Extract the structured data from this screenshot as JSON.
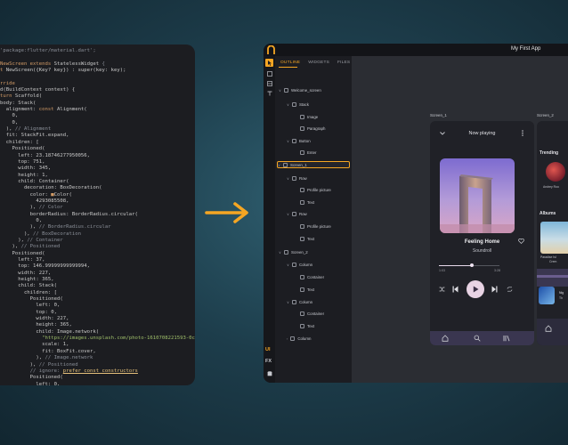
{
  "code": {
    "lines": [
      [
        [
          "c-g",
          "'package:flutter/material.dart';"
        ]
      ],
      [
        [
          "c-w",
          ""
        ]
      ],
      [
        [
          "c-k",
          "NewScreen extends "
        ],
        [
          "c-w",
          "StatelessWidget "
        ],
        [
          "c-g",
          "{"
        ]
      ],
      [
        [
          "c-k",
          "t "
        ],
        [
          "c-w",
          "NewScreen({Key? key}) : super(key: key);"
        ]
      ],
      [
        [
          "c-w",
          ""
        ]
      ],
      [
        [
          "c-k",
          "rride"
        ]
      ],
      [
        [
          "c-w",
          "d(BuildContext context) {"
        ]
      ],
      [
        [
          "c-k",
          "turn "
        ],
        [
          "c-w",
          "Scaffold("
        ]
      ],
      [
        [
          "c-w",
          "body: Stack("
        ]
      ],
      [
        [
          "c-w",
          "  alignment: "
        ],
        [
          "c-k",
          "const "
        ],
        [
          "c-w",
          "Alignment("
        ]
      ],
      [
        [
          "c-w",
          "    0,"
        ]
      ],
      [
        [
          "c-w",
          "    0,"
        ]
      ],
      [
        [
          "c-w",
          "  ), "
        ],
        [
          "c-g",
          "// Alignment"
        ]
      ],
      [
        [
          "c-w",
          "  fit: StackFit.expand,"
        ]
      ],
      [
        [
          "c-w",
          "  children: ["
        ]
      ],
      [
        [
          "c-w",
          "    Positioned("
        ]
      ],
      [
        [
          "c-w",
          "      left: 23.18746277950056,"
        ]
      ],
      [
        [
          "c-w",
          "      top: 751,"
        ]
      ],
      [
        [
          "c-w",
          "      width: 345,"
        ]
      ],
      [
        [
          "c-w",
          "      height: 1,"
        ]
      ],
      [
        [
          "c-w",
          "      child: Container("
        ]
      ],
      [
        [
          "c-w",
          "        decoration: BoxDecoration("
        ]
      ],
      [
        [
          "c-w",
          "          color: "
        ],
        [
          "c-k",
          "■"
        ],
        [
          "c-w",
          "Color("
        ]
      ],
      [
        [
          "c-w",
          "            4293085508,"
        ]
      ],
      [
        [
          "c-w",
          "          ), "
        ],
        [
          "c-g",
          "// Color"
        ]
      ],
      [
        [
          "c-w",
          "          borderRadius: BorderRadius.circular("
        ]
      ],
      [
        [
          "c-w",
          "            0,"
        ]
      ],
      [
        [
          "c-w",
          "          ), "
        ],
        [
          "c-g",
          "// BorderRadius.circular"
        ]
      ],
      [
        [
          "c-w",
          "        ), "
        ],
        [
          "c-g",
          "// BoxDecoration"
        ]
      ],
      [
        [
          "c-w",
          "      ), "
        ],
        [
          "c-g",
          "// Container"
        ]
      ],
      [
        [
          "c-w",
          "    ), "
        ],
        [
          "c-g",
          "// Positioned"
        ]
      ],
      [
        [
          "c-w",
          "    Positioned("
        ]
      ],
      [
        [
          "c-w",
          "      left: 37,"
        ]
      ],
      [
        [
          "c-w",
          "      top: 146.99999999999994,"
        ]
      ],
      [
        [
          "c-w",
          "      width: 227,"
        ]
      ],
      [
        [
          "c-w",
          "      height: 365,"
        ]
      ],
      [
        [
          "c-w",
          "      child: Stack("
        ]
      ],
      [
        [
          "c-w",
          "        children: ["
        ]
      ],
      [
        [
          "c-w",
          "          Positioned("
        ]
      ],
      [
        [
          "c-w",
          "            left: 0,"
        ]
      ],
      [
        [
          "c-w",
          "            top: 0,"
        ]
      ],
      [
        [
          "c-w",
          "            width: 227,"
        ]
      ],
      [
        [
          "c-w",
          "            height: 365,"
        ]
      ],
      [
        [
          "c-w",
          "            child: Image.network("
        ]
      ],
      [
        [
          "c-w",
          "              "
        ],
        [
          "c-s",
          "\"https://images.unsplash.com/photo-1610708221593-0c900c4551d3"
        ]
      ],
      [
        [
          "c-w",
          "              scale: 1,"
        ]
      ],
      [
        [
          "c-w",
          "              fit: BoxFit.cover,"
        ]
      ],
      [
        [
          "c-w",
          "            ), "
        ],
        [
          "c-g",
          "// Image.network"
        ]
      ],
      [
        [
          "c-w",
          "          ), "
        ],
        [
          "c-g",
          "// Positioned"
        ]
      ],
      [
        [
          "c-w",
          "          "
        ],
        [
          "c-g",
          "// ignore: "
        ],
        [
          "c-u",
          "prefer_const_constructors"
        ]
      ],
      [
        [
          "c-w",
          "          Positioned("
        ]
      ],
      [
        [
          "c-w",
          "            left: 0,"
        ]
      ]
    ]
  },
  "app": {
    "title": "My First App",
    "tabs": [
      "OUTLINE",
      "WIDGETS",
      "FILES"
    ],
    "rail_text": [
      "UI",
      "FX"
    ],
    "tree": [
      {
        "label": "Welcome_screen",
        "indent": 0,
        "chev": "∨",
        "icon": true
      },
      {
        "label": "Stack",
        "indent": 1,
        "chev": "∨",
        "icon": true
      },
      {
        "label": "Image",
        "indent": 2,
        "chev": "",
        "icon": true
      },
      {
        "label": "Paragraph",
        "indent": 2,
        "chev": "",
        "icon": true
      },
      {
        "label": "Button",
        "indent": 1,
        "chev": "∨",
        "icon": true
      },
      {
        "label": "Enter",
        "indent": 2,
        "chev": "",
        "icon": true
      },
      {
        "label": "Screen_1",
        "indent": 0,
        "chev": "∨",
        "icon": true,
        "selected": true
      },
      {
        "label": "Row",
        "indent": 1,
        "chev": "∨",
        "icon": true
      },
      {
        "label": "Profile picture",
        "indent": 2,
        "chev": "",
        "icon": true
      },
      {
        "label": "Text",
        "indent": 2,
        "chev": "",
        "icon": true
      },
      {
        "label": "Row",
        "indent": 1,
        "chev": "∨",
        "icon": true
      },
      {
        "label": "Profile picture",
        "indent": 2,
        "chev": "",
        "icon": true
      },
      {
        "label": "Text",
        "indent": 2,
        "chev": "",
        "icon": true
      },
      {
        "label": "Screen_2",
        "indent": 0,
        "chev": "∨",
        "icon": true
      },
      {
        "label": "Column",
        "indent": 1,
        "chev": "∨",
        "icon": true
      },
      {
        "label": "Container",
        "indent": 2,
        "chev": "",
        "icon": true
      },
      {
        "label": "Text",
        "indent": 2,
        "chev": "",
        "icon": true
      },
      {
        "label": "Column",
        "indent": 1,
        "chev": "∨",
        "icon": true
      },
      {
        "label": "Container",
        "indent": 2,
        "chev": "",
        "icon": true
      },
      {
        "label": "Text",
        "indent": 2,
        "chev": "",
        "icon": true
      },
      {
        "label": "Column",
        "indent": 1,
        "chev": "›",
        "icon": true
      }
    ],
    "screen1_label": "Screen_1",
    "screen2_label": "Screen_2",
    "player": {
      "header": "Now playing",
      "song": "Feeling Home",
      "artist": "Soundroll",
      "elapsed": "1:03",
      "total": "3:28",
      "progress": 0.55
    },
    "screen2": {
      "trending": "Trending",
      "artist_name": "Andrey Roo",
      "albums": "Albums",
      "album_title": "Paradise Isl",
      "album_sub": "Crem",
      "mini_title": "Nig",
      "mini_sub": "Th"
    },
    "colors": {
      "accent": "#f5a623",
      "play": "#e8d3e4",
      "navbar": "#3a3650"
    }
  }
}
